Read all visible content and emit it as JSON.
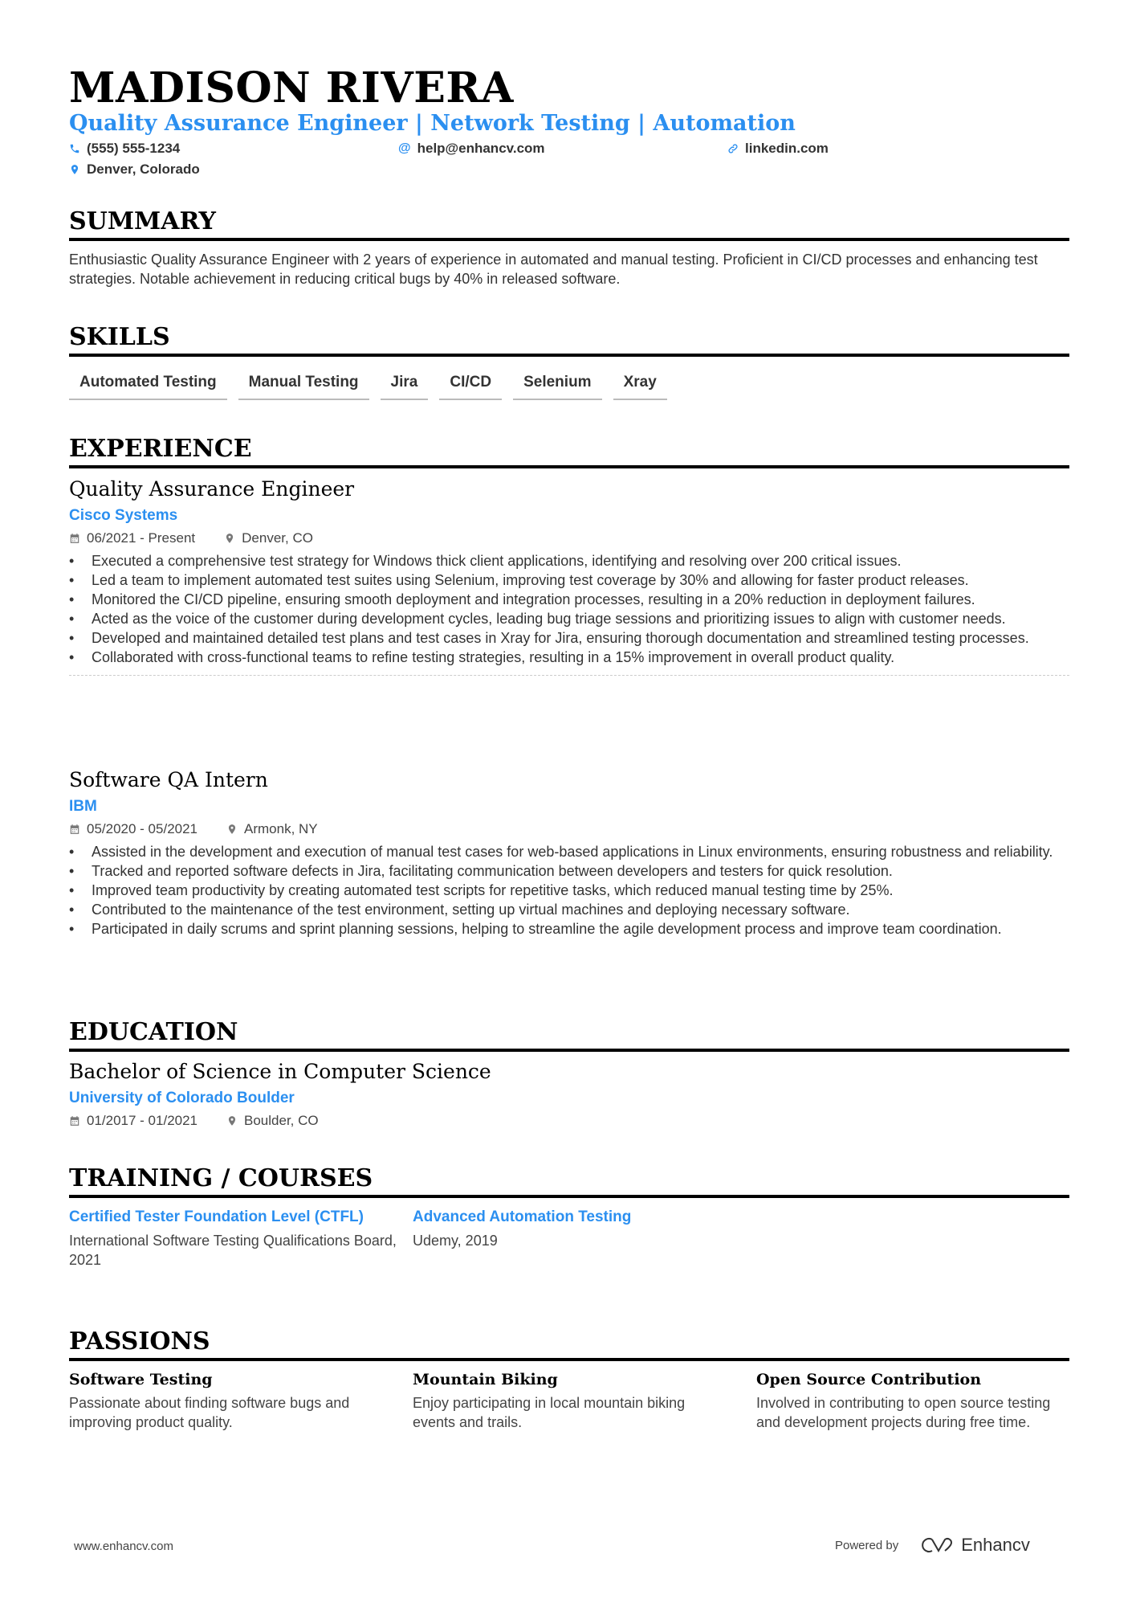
{
  "header": {
    "name": "MADISON RIVERA",
    "subtitle": "Quality Assurance Engineer | Network Testing | Automation",
    "phone": "(555) 555-1234",
    "email": "help@enhancv.com",
    "linkedin": "linkedin.com",
    "location": "Denver, Colorado"
  },
  "colors": {
    "accent": "#2b8ff0",
    "text": "#333333",
    "heading": "#000000"
  },
  "summary": {
    "title": "SUMMARY",
    "text": "Enthusiastic Quality Assurance Engineer with 2 years of experience in automated and manual testing. Proficient in CI/CD processes and enhancing test strategies. Notable achievement in reducing critical bugs by 40% in released software."
  },
  "skills": {
    "title": "SKILLS",
    "items": [
      "Automated Testing",
      "Manual Testing",
      "Jira",
      "CI/CD",
      "Selenium",
      "Xray"
    ]
  },
  "experience": {
    "title": "EXPERIENCE",
    "jobs": [
      {
        "title": "Quality Assurance Engineer",
        "company": "Cisco Systems",
        "dates": "06/2021 - Present",
        "location": "Denver, CO",
        "bullets": [
          "Executed a comprehensive test strategy for Windows thick client applications, identifying and resolving over 200 critical issues.",
          "Led a team to implement automated test suites using Selenium, improving test coverage by 30% and allowing for faster product releases.",
          "Monitored the CI/CD pipeline, ensuring smooth deployment and integration processes, resulting in a 20% reduction in deployment failures.",
          "Acted as the voice of the customer during development cycles, leading bug triage sessions and prioritizing issues to align with customer needs.",
          "Developed and maintained detailed test plans and test cases in Xray for Jira, ensuring thorough documentation and streamlined testing processes.",
          "Collaborated with cross-functional teams to refine testing strategies, resulting in a 15% improvement in overall product quality."
        ]
      },
      {
        "title": "Software QA Intern",
        "company": "IBM",
        "dates": "05/2020 - 05/2021",
        "location": "Armonk, NY",
        "bullets": [
          "Assisted in the development and execution of manual test cases for web-based applications in Linux environments, ensuring robustness and reliability.",
          "Tracked and reported software defects in Jira, facilitating communication between developers and testers for quick resolution.",
          "Improved team productivity by creating automated test scripts for repetitive tasks, which reduced manual testing time by 25%.",
          "Contributed to the maintenance of the test environment, setting up virtual machines and deploying necessary software.",
          "Participated in daily scrums and sprint planning sessions, helping to streamline the agile development process and improve team coordination."
        ]
      }
    ]
  },
  "education": {
    "title": "EDUCATION",
    "degree": "Bachelor of Science in Computer Science",
    "school": "University of Colorado Boulder",
    "dates": "01/2017 - 01/2021",
    "location": "Boulder, CO"
  },
  "training": {
    "title": "TRAINING / COURSES",
    "items": [
      {
        "title": "Certified Tester Foundation Level (CTFL)",
        "desc": "International Software Testing Qualifications Board, 2021"
      },
      {
        "title": "Advanced Automation Testing",
        "desc": "Udemy, 2019"
      }
    ]
  },
  "passions": {
    "title": "PASSIONS",
    "items": [
      {
        "title": "Software Testing",
        "desc": "Passionate about finding software bugs and improving product quality."
      },
      {
        "title": "Mountain Biking",
        "desc": "Enjoy participating in local mountain biking events and trails."
      },
      {
        "title": "Open Source Contribution",
        "desc": "Involved in contributing to open source testing and development projects during free time."
      }
    ]
  },
  "footer": {
    "website": "www.enhancv.com",
    "powered_by": "Powered by",
    "brand": "Enhancv"
  }
}
